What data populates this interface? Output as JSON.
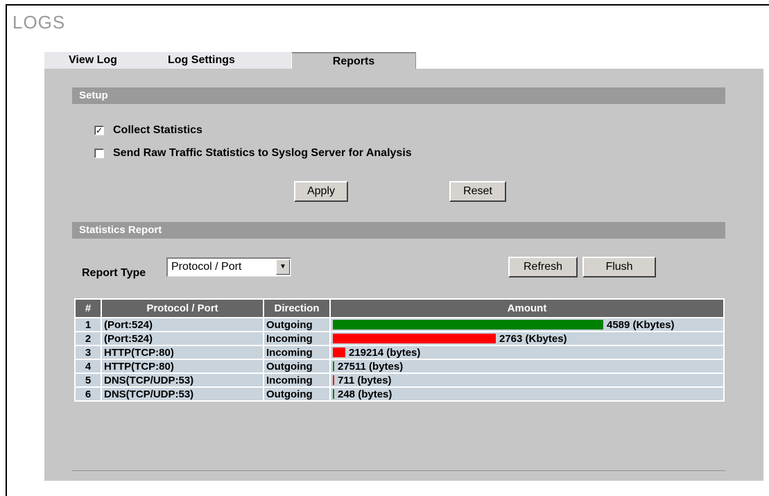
{
  "page": {
    "title": "LOGS"
  },
  "tabs": [
    {
      "label": "View Log",
      "active": false
    },
    {
      "label": "Log Settings",
      "active": false
    },
    {
      "label": "Reports",
      "active": true
    }
  ],
  "setup": {
    "title": "Setup",
    "collect_statistics": {
      "label": "Collect Statistics",
      "checked": true
    },
    "send_raw": {
      "label": "Send Raw Traffic Statistics to Syslog Server for Analysis",
      "checked": false
    },
    "apply_label": "Apply",
    "reset_label": "Reset"
  },
  "statistics": {
    "title": "Statistics Report",
    "report_type_label": "Report Type",
    "report_type_value": "Protocol / Port",
    "refresh_label": "Refresh",
    "flush_label": "Flush",
    "columns": [
      "#",
      "Protocol / Port",
      "Direction",
      "Amount"
    ],
    "rows": [
      {
        "num": "1",
        "protocol": "(Port:524)",
        "direction": "Outgoing",
        "amount": "4589 (Kbytes)",
        "bar_fraction": 1.0
      },
      {
        "num": "2",
        "protocol": "(Port:524)",
        "direction": "Incoming",
        "amount": "2763 (Kbytes)",
        "bar_fraction": 0.602
      },
      {
        "num": "3",
        "protocol": "HTTP(TCP:80)",
        "direction": "Incoming",
        "amount": "219214 (bytes)",
        "bar_fraction": 0.047
      },
      {
        "num": "4",
        "protocol": "HTTP(TCP:80)",
        "direction": "Outgoing",
        "amount": "27511 (bytes)",
        "bar_fraction": 0.006
      },
      {
        "num": "5",
        "protocol": "DNS(TCP/UDP:53)",
        "direction": "Incoming",
        "amount": "711 (bytes)",
        "bar_fraction": 0.0002
      },
      {
        "num": "6",
        "protocol": "DNS(TCP/UDP:53)",
        "direction": "Outgoing",
        "amount": "248 (bytes)",
        "bar_fraction": 0.0001
      }
    ]
  },
  "colors": {
    "outgoing": "#008000",
    "incoming": "#ff0000"
  }
}
